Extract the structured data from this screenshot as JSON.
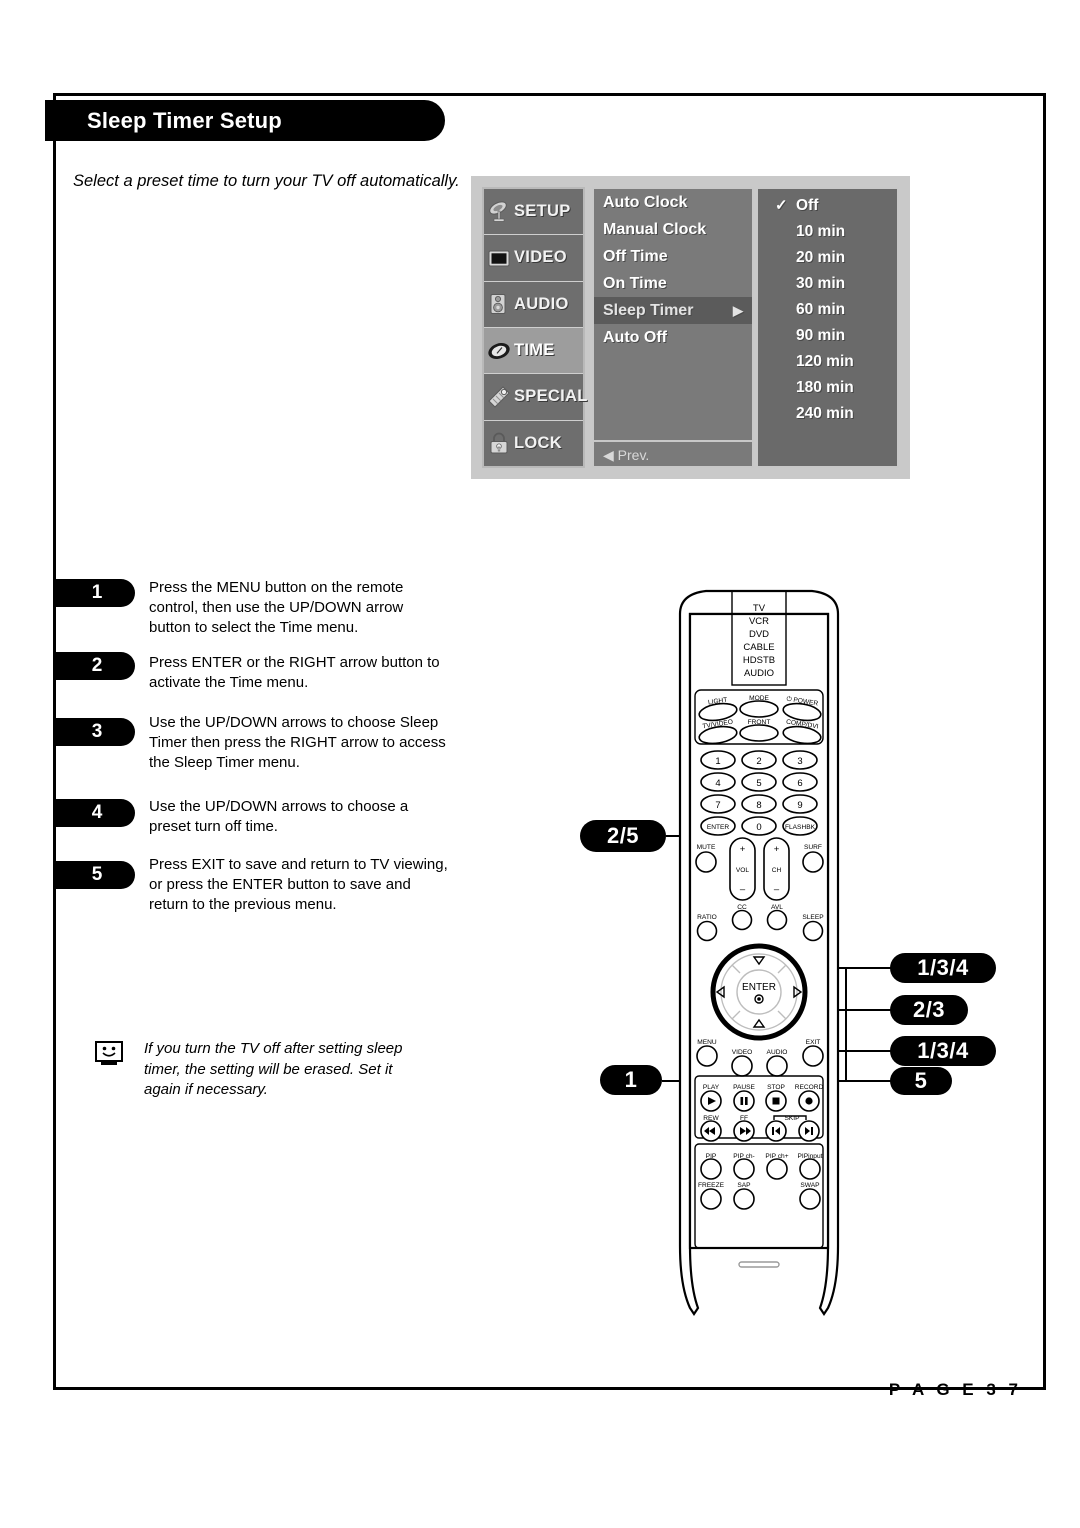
{
  "page": {
    "title": "Sleep Timer Setup",
    "intro": "Select a preset time to turn your TV off automatically.",
    "page_label": "P A G E   3 7"
  },
  "osd": {
    "categories": [
      {
        "label": "SETUP",
        "icon": "satellite-dish-icon",
        "selected": false
      },
      {
        "label": "VIDEO",
        "icon": "monitor-icon",
        "selected": false
      },
      {
        "label": "AUDIO",
        "icon": "speaker-icon",
        "selected": false
      },
      {
        "label": "TIME",
        "icon": "clock-icon",
        "selected": true
      },
      {
        "label": "SPECIAL",
        "icon": "tag-icon",
        "selected": false
      },
      {
        "label": "LOCK",
        "icon": "padlock-icon",
        "selected": false
      }
    ],
    "menu_items": [
      {
        "label": "Auto Clock",
        "highlighted": false
      },
      {
        "label": "Manual Clock",
        "highlighted": false
      },
      {
        "label": "Off Time",
        "highlighted": false
      },
      {
        "label": "On Time",
        "highlighted": false
      },
      {
        "label": "Sleep Timer",
        "highlighted": true,
        "arrow": "▶"
      },
      {
        "label": "Auto Off",
        "highlighted": false
      }
    ],
    "prev_label": "◀ Prev.",
    "options": [
      {
        "label": "Off",
        "checked": true,
        "check": "✓"
      },
      {
        "label": "10 min",
        "checked": false
      },
      {
        "label": "20 min",
        "checked": false
      },
      {
        "label": "30 min",
        "checked": false
      },
      {
        "label": "60 min",
        "checked": false
      },
      {
        "label": "90 min",
        "checked": false
      },
      {
        "label": "120 min",
        "checked": false
      },
      {
        "label": "180 min",
        "checked": false
      },
      {
        "label": "240 min",
        "checked": false
      }
    ]
  },
  "steps": [
    {
      "num": "1",
      "text": "Press the MENU button on the remote control, then use the UP/DOWN arrow button to select the Time menu."
    },
    {
      "num": "2",
      "text": "Press ENTER or the RIGHT arrow button to activate the Time menu."
    },
    {
      "num": "3",
      "text": "Use the UP/DOWN arrows to choose Sleep Timer then press the RIGHT arrow to access the Sleep Timer menu."
    },
    {
      "num": "4",
      "text": "Use the UP/DOWN arrows to choose a preset turn off time."
    },
    {
      "num": "5",
      "text": "Press EXIT to save and return to TV viewing, or press the ENTER button to save and return to the previous menu."
    }
  ],
  "note": {
    "icon": "tv-face-icon",
    "text": "If you turn the TV off after setting sleep timer, the setting will be erased. Set it again if necessary."
  },
  "callouts": [
    {
      "label": "2/5",
      "target": "enter-number-button"
    },
    {
      "label": "1/3/4",
      "target": "up-arrow-button"
    },
    {
      "label": "2/3",
      "target": "right-arrow-button"
    },
    {
      "label": "1/3/4",
      "target": "down-arrow-button"
    },
    {
      "label": "5",
      "target": "exit-button"
    },
    {
      "label": "1",
      "target": "menu-button"
    }
  ],
  "remote": {
    "device_modes": [
      "TV",
      "VCR",
      "DVD",
      "CABLE",
      "HDSTB",
      "AUDIO"
    ],
    "row_light": [
      "LIGHT",
      "MODE",
      "POWER"
    ],
    "row_input": [
      "TV/VIDEO",
      "FRONT",
      "COMP/DVI"
    ],
    "keypad": [
      "1",
      "2",
      "3",
      "4",
      "5",
      "6",
      "7",
      "8",
      "9",
      "ENTER",
      "0",
      "FLASHBK"
    ],
    "row_mute": [
      "MUTE",
      "VOL",
      "CH",
      "SURF"
    ],
    "row_ratio": [
      "RATIO",
      "CC",
      "AVL",
      "SLEEP"
    ],
    "nav_center": "ENTER",
    "row_menu": [
      "MENU",
      "VIDEO",
      "AUDIO",
      "EXIT"
    ],
    "row_play": [
      "PLAY",
      "PAUSE",
      "STOP",
      "RECORD"
    ],
    "row_rew": [
      "REW",
      "FF",
      "SKIP"
    ],
    "row_pip": [
      "PIP",
      "PIP ch-",
      "PIP ch+",
      "PIPinput"
    ],
    "row_freeze": [
      "FREEZE",
      "SAP",
      "SWAP"
    ]
  },
  "colors": {
    "osd_background": "#c9c9c9",
    "osd_panel": "#6e6e6e",
    "osd_highlight": "#5b5b5b",
    "osd_selected_category": "#9d9d9d",
    "accent_black": "#000000"
  }
}
